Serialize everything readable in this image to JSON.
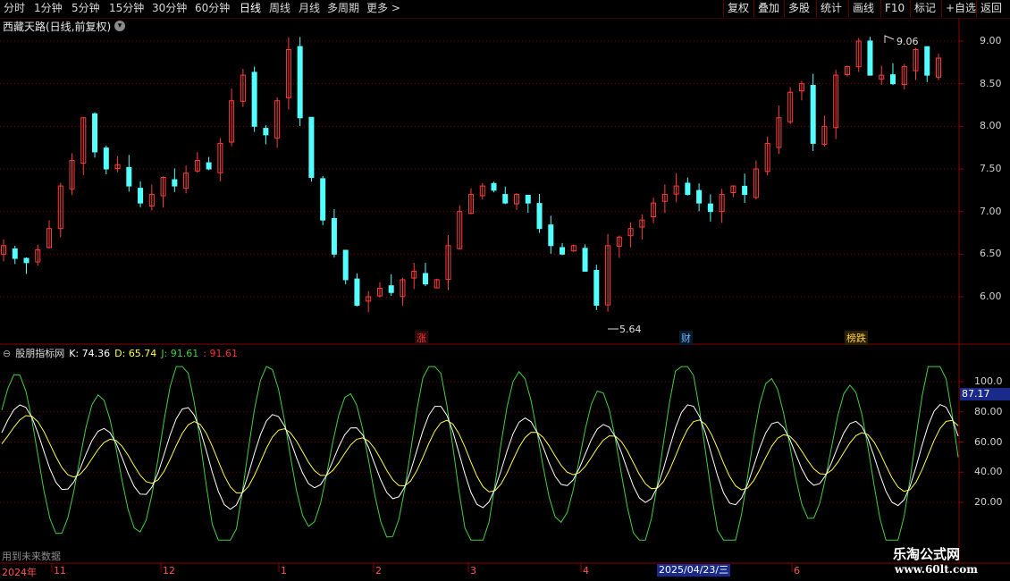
{
  "toolbar": {
    "periods": [
      "分时",
      "1分钟",
      "5分钟",
      "15分钟",
      "30分钟",
      "60分钟",
      "日线",
      "周线",
      "月线",
      "多周期",
      "更多 >"
    ],
    "active": "日线",
    "buttons": [
      "复权",
      "叠加",
      "多股",
      "统计",
      "画线",
      "F10",
      "标记",
      "+自选",
      "返回"
    ]
  },
  "main_chart": {
    "title": "西藏天路(日线,前复权)",
    "price_axis": [
      "9.00",
      "8.50",
      "8.00",
      "7.50",
      "7.00",
      "6.50",
      "6.00"
    ],
    "high_marker": "9.06",
    "low_marker": "5.64",
    "event_tags": [
      {
        "text": "涨",
        "color": "#ff3030"
      },
      {
        "text": "财",
        "color": "#6fb5ff"
      },
      {
        "text": "榜跌",
        "color": "#ffd23a"
      }
    ]
  },
  "indicator": {
    "name": "股朋指标网",
    "k_label": "K: 74.36",
    "d_label": "D: 65.74",
    "j_label": "J: 91.61",
    "extra_label": ": 91.61",
    "axis": [
      "100.0",
      "80.00",
      "60.00",
      "40.00",
      "20.00"
    ],
    "current_value": "87.17",
    "future_note": "用到未来数据"
  },
  "time_axis": {
    "year_label": "2024年",
    "months": [
      "11",
      "12",
      "1",
      "2",
      "3",
      "4",
      "5",
      "6"
    ],
    "current_date": "2025/04/23/三"
  },
  "watermark": {
    "line1": "乐淘公式网",
    "line2": "www.60lt.com"
  },
  "colors": {
    "up": "#ff3c3c",
    "down": "#54ffff",
    "k_line": "#ffffff",
    "d_line": "#ffff40",
    "j_line": "#40d040",
    "j_hi": "#ff2020",
    "grid": "#7a0000"
  },
  "chart_data": {
    "type": "candlestick",
    "x_range": [
      "2024-10",
      "2025-06"
    ],
    "price_range": [
      5.64,
      9.06
    ],
    "price_series_close": [
      6.6,
      6.45,
      6.4,
      6.55,
      6.8,
      7.3,
      7.6,
      8.1,
      7.7,
      7.5,
      7.55,
      7.3,
      7.1,
      7.2,
      7.4,
      7.3,
      7.45,
      7.6,
      7.5,
      7.8,
      8.3,
      8.6,
      8.0,
      7.9,
      8.3,
      8.9,
      8.1,
      7.4,
      6.9,
      6.5,
      6.2,
      5.9,
      6.0,
      6.1,
      6.05,
      6.2,
      6.3,
      6.15,
      6.2,
      6.6,
      7.0,
      7.2,
      7.3,
      7.25,
      7.1,
      7.2,
      7.1,
      6.8,
      6.6,
      6.5,
      6.6,
      6.3,
      5.9,
      6.6,
      6.7,
      6.8,
      6.9,
      7.1,
      7.2,
      7.3,
      7.2,
      7.1,
      7.0,
      7.2,
      7.3,
      7.2,
      7.5,
      7.8,
      8.1,
      8.4,
      8.5,
      7.8,
      8.0,
      8.6,
      8.7,
      9.0,
      8.6,
      8.6,
      8.5,
      8.7,
      8.9,
      8.6,
      8.8
    ],
    "kdj": {
      "k_last": 74.36,
      "d_last": 65.74,
      "j_last": 91.61,
      "axis_range": [
        0,
        110
      ]
    }
  }
}
